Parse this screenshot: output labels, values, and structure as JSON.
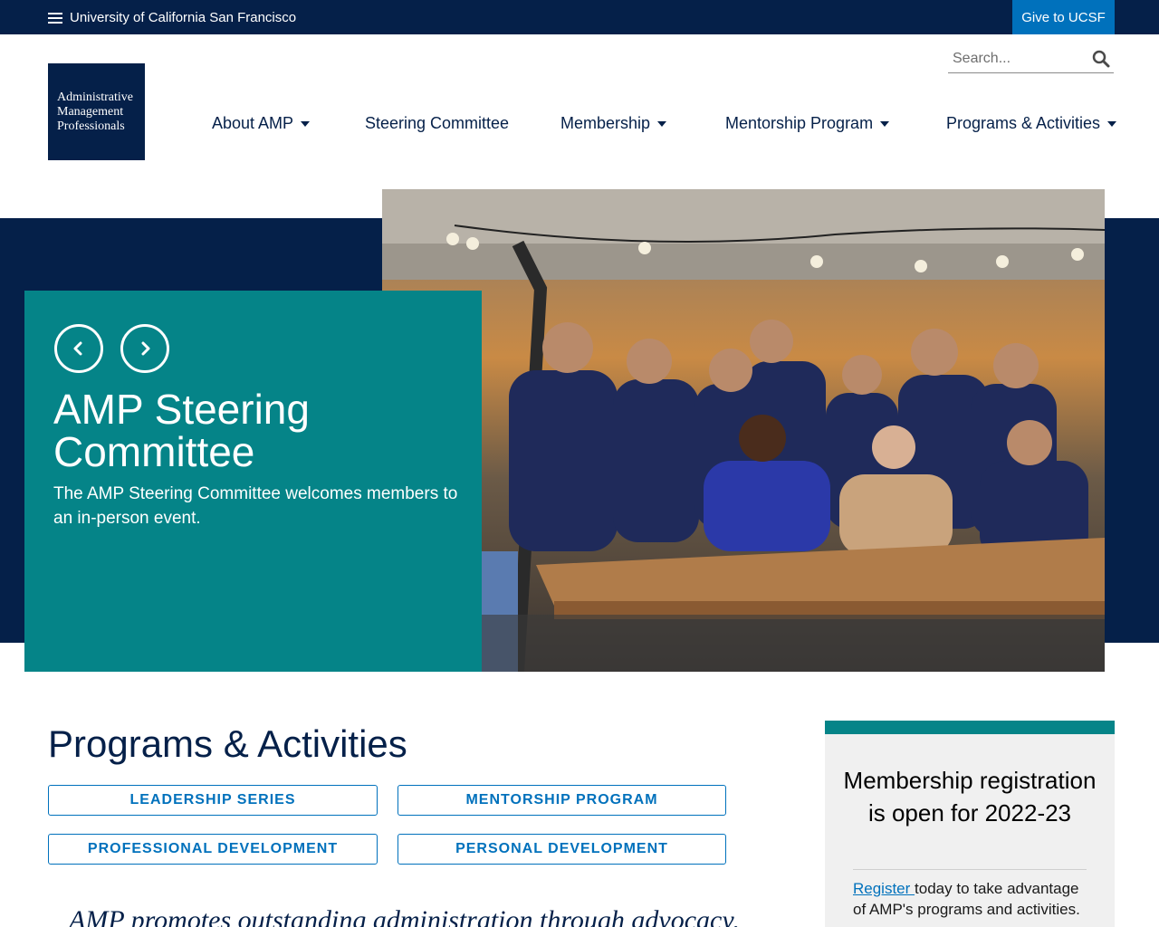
{
  "topbar": {
    "ucsf_label": "University of California San Francisco",
    "give_label": "Give to UCSF"
  },
  "logo": {
    "line1": "Administrative",
    "line2": "Management",
    "line3": "Professionals"
  },
  "search": {
    "placeholder": "Search...",
    "icon": "search-icon"
  },
  "nav": {
    "about": "About AMP",
    "steering": "Steering Committee",
    "membership": "Membership",
    "mentorship": "Mentorship Program",
    "programs": "Programs & Activities"
  },
  "hero": {
    "title": "AMP Steering Committee",
    "description": "The AMP Steering Committee welcomes members to an in-person event.",
    "prev_icon": "chevron-left-icon",
    "next_icon": "chevron-right-icon"
  },
  "programs": {
    "title": "Programs & Activities",
    "buttons": [
      "LEADERSHIP SERIES",
      "MENTORSHIP PROGRAM",
      "PROFESSIONAL DEVELOPMENT",
      "PERSONAL DEVELOPMENT"
    ],
    "quote": "AMP promotes outstanding administration through advocacy,"
  },
  "sidebar": {
    "title": "Membership registration is open for 2022-23",
    "link_text": "Register ",
    "body_text": "today to take advantage of AMP's programs and activities."
  },
  "colors": {
    "navy": "#052049",
    "teal": "#058488",
    "blue": "#0071bc"
  }
}
